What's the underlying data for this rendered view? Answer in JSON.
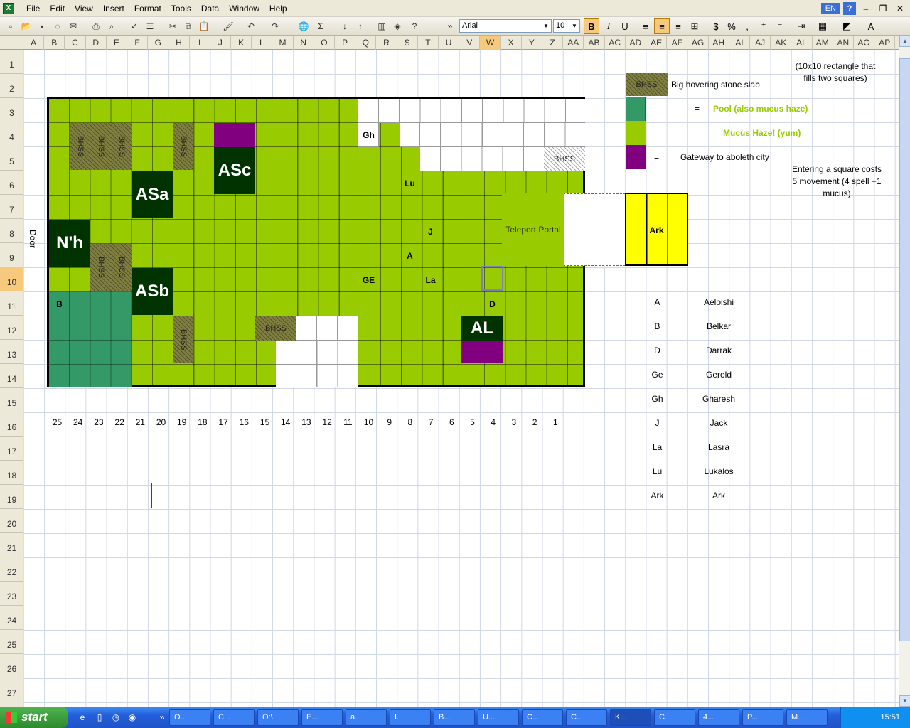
{
  "app": {
    "title": "Microsoft Excel"
  },
  "menu": [
    "File",
    "Edit",
    "View",
    "Insert",
    "Format",
    "Tools",
    "Data",
    "Window",
    "Help"
  ],
  "help_lang": "EN",
  "help_q": "?",
  "toolbar": {
    "font": "Arial",
    "size": "10",
    "bold": "B",
    "italic": "I",
    "underline": "U"
  },
  "columns": [
    "A",
    "B",
    "C",
    "D",
    "E",
    "F",
    "G",
    "H",
    "I",
    "J",
    "K",
    "L",
    "M",
    "N",
    "O",
    "P",
    "Q",
    "R",
    "S",
    "T",
    "U",
    "V",
    "W",
    "X",
    "Y",
    "Z",
    "AA",
    "AB",
    "AC",
    "AD",
    "AE",
    "AF",
    "AG",
    "AH",
    "AI",
    "AJ",
    "AK",
    "AL",
    "AM",
    "AN",
    "AO",
    "AP"
  ],
  "selected_column": "W",
  "rows": [
    "1",
    "2",
    "3",
    "4",
    "5",
    "6",
    "7",
    "8",
    "9",
    "10",
    "11",
    "12",
    "13",
    "14",
    "15",
    "16",
    "17",
    "18",
    "19",
    "20",
    "21",
    "22",
    "23",
    "24",
    "25",
    "26",
    "27"
  ],
  "selected_row": "10",
  "map": {
    "bhss": "BHSS",
    "tokens": {
      "asa": "ASa",
      "asb": "ASb",
      "asc": "ASc",
      "nh": "N'h",
      "al": "AL"
    },
    "letters": {
      "gh": "Gh",
      "lu": "Lu",
      "j": "J",
      "a": "A",
      "ge": "GE",
      "la": "La",
      "d": "D",
      "b": "B"
    },
    "door": "Door",
    "teleport": "Teleport Portal",
    "axis": [
      "25",
      "24",
      "23",
      "22",
      "21",
      "20",
      "19",
      "18",
      "17",
      "16",
      "15",
      "14",
      "13",
      "12",
      "11",
      "10",
      "9",
      "8",
      "7",
      "6",
      "5",
      "4",
      "3",
      "2",
      "1"
    ]
  },
  "legend": {
    "slab_note": "(10x10 rectangle that fills two squares)",
    "bhss_label": "BHSS",
    "bhss_desc": "Big hovering stone slab",
    "eq": "=",
    "pool": "Pool (also mucus haze)",
    "mucus": "Mucus Haze! (yum)",
    "gateway": "Gateway to aboleth city",
    "movement_note": "Entering a square costs 5 movement (4 spell +1 mucus)",
    "ark": "Ark"
  },
  "characters": [
    {
      "key": "A",
      "name": "Aeloishi"
    },
    {
      "key": "B",
      "name": "Belkar"
    },
    {
      "key": "D",
      "name": "Darrak"
    },
    {
      "key": "Ge",
      "name": "Gerold"
    },
    {
      "key": "Gh",
      "name": "Gharesh"
    },
    {
      "key": "J",
      "name": "Jack"
    },
    {
      "key": "La",
      "name": "Lasra"
    },
    {
      "key": "Lu",
      "name": "Lukalos"
    },
    {
      "key": "Ark",
      "name": "Ark"
    }
  ],
  "taskbar": {
    "start": "start",
    "tasks": [
      "O...",
      "C...",
      "O:\\",
      "E...",
      "a...",
      "I...",
      "B...",
      "U...",
      "C...",
      "C...",
      "K...",
      "C...",
      "4...",
      "P...",
      "M..."
    ],
    "active_task": 10,
    "clock": "15:51"
  },
  "colors": {
    "mucus": "#99cc00",
    "pool": "#339966",
    "gateway": "#800080",
    "token": "#003300",
    "ark": "#ffff00"
  }
}
